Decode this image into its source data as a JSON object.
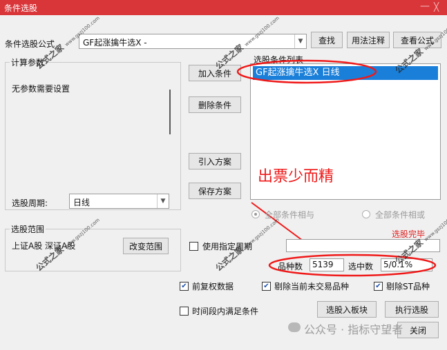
{
  "window": {
    "title": "条件选股",
    "minimize": "—",
    "close": "╳"
  },
  "formula": {
    "label": "条件选股公式",
    "value": "GF起涨擒牛选X -",
    "find_button": "查找",
    "usage_button": "用法注释",
    "view_button": "查看公式"
  },
  "params": {
    "group_title": "计算参数",
    "none_text": "无参数需要设置"
  },
  "period": {
    "label": "选股周期:",
    "value": "日线"
  },
  "actions": {
    "add": "加入条件",
    "delete": "删除条件",
    "import": "引入方案",
    "save": "保存方案"
  },
  "conditions": {
    "title": "选股条件列表",
    "items": [
      "GF起涨擒牛选X  日线"
    ]
  },
  "logic": {
    "and_label": "全部条件相与",
    "or_label": "全部条件相或",
    "selected": "and"
  },
  "scope": {
    "group_title": "选股范围",
    "value": "上证A股 深证A股",
    "change_button": "改变范围"
  },
  "status": {
    "done": "选股完毕"
  },
  "range_period": {
    "label": "使用指定周期",
    "checked": false
  },
  "counts": {
    "total_label": "品种数",
    "total_value": "5139",
    "hit_label": "选中数",
    "hit_value": "5/0.1%"
  },
  "options": {
    "adjust": {
      "label": "前复权数据",
      "checked": true
    },
    "exclude_untraded": {
      "label": "剔除当前未交易品种",
      "checked": true
    },
    "exclude_st": {
      "label": "剔除ST品种",
      "checked": true
    },
    "period_match": {
      "label": "时间段内满足条件",
      "checked": false
    }
  },
  "bottom": {
    "to_block": "选股入板块",
    "execute": "执行选股",
    "close": "关闭"
  },
  "annotation": {
    "text": "出票少而精",
    "color": "#f01818"
  },
  "watermarks": {
    "brand": "公式之家",
    "url": "www.gszj100.com",
    "wechat": "公众号 · 指标守望者"
  },
  "colors": {
    "titlebar": "#d9363a",
    "selection": "#1a7fd9",
    "status_red": "#e02020"
  }
}
